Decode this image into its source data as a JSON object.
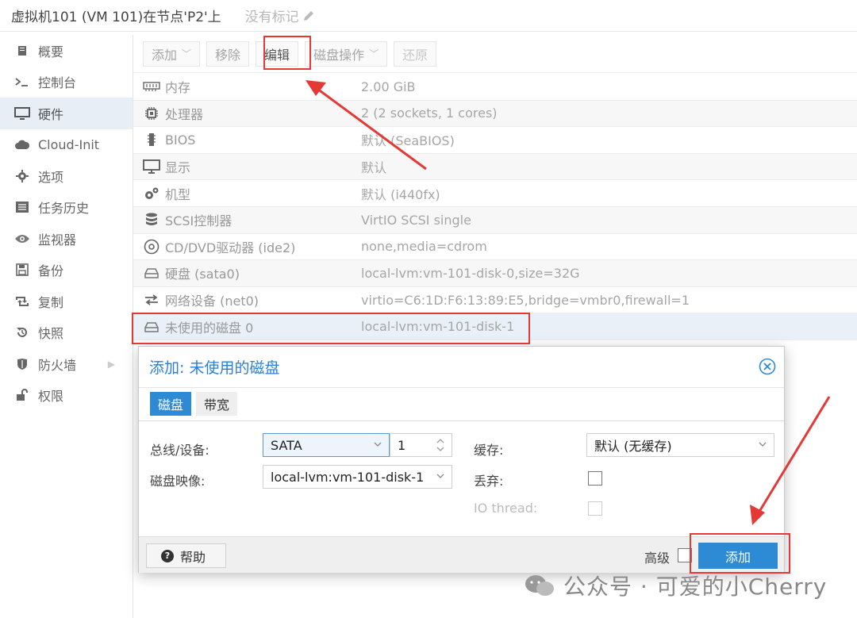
{
  "titlebar": {
    "title": "虚拟机101 (VM 101)在节点'P2'上",
    "tag": "没有标记"
  },
  "sidebar": {
    "items": [
      {
        "label": "概要",
        "icon": "book-icon"
      },
      {
        "label": "控制台",
        "icon": "terminal-icon"
      },
      {
        "label": "硬件",
        "icon": "monitor-icon",
        "active": true
      },
      {
        "label": "Cloud-Init",
        "icon": "cloud-icon"
      },
      {
        "label": "选项",
        "icon": "gear-icon"
      },
      {
        "label": "任务历史",
        "icon": "list-icon"
      },
      {
        "label": "监视器",
        "icon": "eye-icon"
      },
      {
        "label": "备份",
        "icon": "floppy-icon"
      },
      {
        "label": "复制",
        "icon": "retweet-icon"
      },
      {
        "label": "快照",
        "icon": "history-icon"
      },
      {
        "label": "防火墙",
        "icon": "shield-icon"
      },
      {
        "label": "权限",
        "icon": "unlock-icon"
      }
    ]
  },
  "toolbar": {
    "add": "添加",
    "remove": "移除",
    "edit": "编辑",
    "disk_action": "磁盘操作",
    "revert": "还原"
  },
  "hardware": [
    {
      "icon": "memory-icon",
      "name": "内存",
      "value": "2.00 GiB"
    },
    {
      "icon": "cpu-icon",
      "name": "处理器",
      "value": "2 (2 sockets, 1 cores)"
    },
    {
      "icon": "chip-icon",
      "name": "BIOS",
      "value": "默认 (SeaBIOS)"
    },
    {
      "icon": "display-icon",
      "name": "显示",
      "value": "默认"
    },
    {
      "icon": "cogs-icon",
      "name": "机型",
      "value": "默认 (i440fx)"
    },
    {
      "icon": "database-icon",
      "name": "SCSI控制器",
      "value": "VirtIO SCSI single"
    },
    {
      "icon": "cdrom-icon",
      "name": "CD/DVD驱动器 (ide2)",
      "value": "none,media=cdrom"
    },
    {
      "icon": "hdd-icon",
      "name": "硬盘 (sata0)",
      "value": "local-lvm:vm-101-disk-0,size=32G"
    },
    {
      "icon": "exchange-icon",
      "name": "网络设备 (net0)",
      "value": "virtio=C6:1D:F6:13:89:E5,bridge=vmbr0,firewall=1"
    },
    {
      "icon": "hdd-icon",
      "name": "未使用的磁盘 0",
      "value": "local-lvm:vm-101-disk-1",
      "selected": true
    }
  ],
  "dialog": {
    "title": "添加: 未使用的磁盘",
    "tabs": [
      "磁盘",
      "带宽"
    ],
    "bus_label": "总线/设备:",
    "bus_value": "SATA",
    "bus_index": "1",
    "image_label": "磁盘映像:",
    "image_value": "local-lvm:vm-101-disk-1",
    "cache_label": "缓存:",
    "cache_value": "默认 (无缓存)",
    "discard_label": "丢弃:",
    "iothread_label": "IO thread:",
    "help": "帮助",
    "advanced": "高级",
    "add": "添加"
  },
  "watermark": "公众号 · 可爱的小Cherry",
  "colors": {
    "accent": "#2d8ad4",
    "annotation": "#e53935"
  }
}
